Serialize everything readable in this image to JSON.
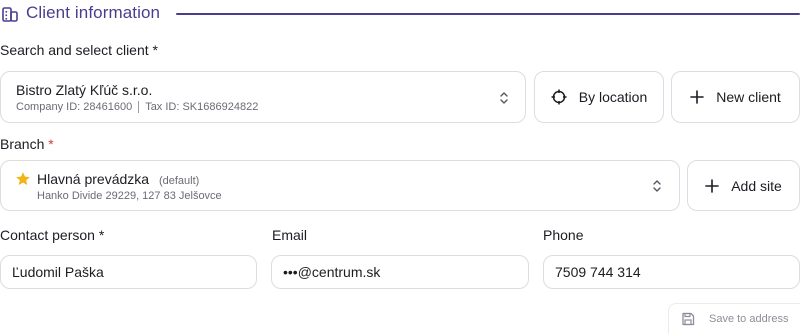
{
  "section": {
    "title": "Client information",
    "icon": "building-icon"
  },
  "client": {
    "label": "Search and select client",
    "required_mark": "*",
    "name": "Bistro Zlatý Kľúč s.r.o.",
    "company_id": "Company ID: 28461600",
    "tax_id": "Tax ID: SK1686924822",
    "by_location_label": "By location",
    "new_client_label": "New client"
  },
  "branch": {
    "label": "Branch",
    "required_mark": "*",
    "name": "Hlavná prevádzka",
    "default_tag": "(default)",
    "address": "Hanko Divide 29229, 127 83 Jelšovce",
    "add_site_label": "Add site"
  },
  "contact": {
    "label": "Contact person",
    "required_mark": "*",
    "value": "Ľudomil Paška"
  },
  "email": {
    "label": "Email",
    "value": "•••@centrum.sk"
  },
  "phone": {
    "label": "Phone",
    "value": "7509 744 314"
  },
  "save_to_address": {
    "label": "Save to address"
  },
  "colors": {
    "accent": "#4a3d8f",
    "required": "#d93a3a",
    "star": "#f2b418"
  }
}
